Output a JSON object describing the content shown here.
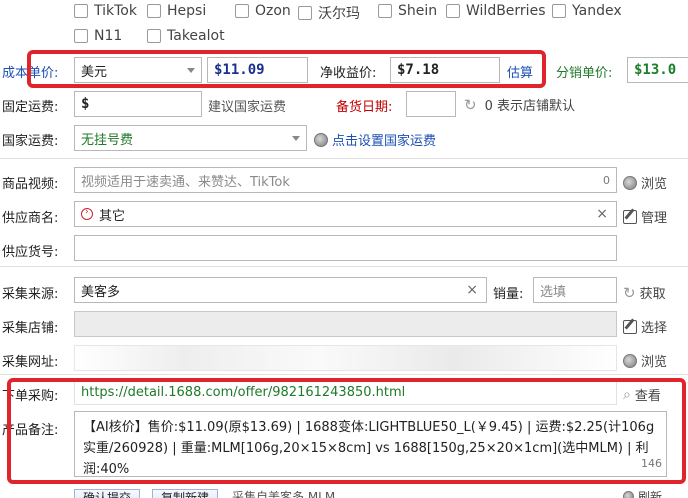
{
  "platforms": {
    "row1": [
      "TikTok",
      "Hepsi",
      "Ozon",
      "沃尔玛",
      "Shein",
      "WildBerries",
      "Yandex"
    ],
    "row2": [
      "N11",
      "Takealot"
    ]
  },
  "cost": {
    "label": "成本单价:",
    "currency": "美元",
    "value": "$11.09",
    "net_label": "净收益价:",
    "net_value": "$7.18",
    "estimate_link": "估算",
    "dist_label": "分销单价:",
    "dist_value": "$13.0"
  },
  "fixed_shipping": {
    "label": "固定运费:",
    "value": "$",
    "hint": "建议国家运费",
    "stock_label": "备货日期:",
    "stock_value": "",
    "stock_hint": "0 表示店铺默认"
  },
  "country_shipping": {
    "label": "国家运费:",
    "value": "无挂号费",
    "link": "点击设置国家运费"
  },
  "video": {
    "label": "商品视频:",
    "placeholder": "视频适用于速卖通、来赞达、TikTok",
    "count": "0",
    "browse": "浏览"
  },
  "supplier": {
    "label": "供应商名:",
    "value": "其它",
    "manage": "管理"
  },
  "supplier_sku": {
    "label": "供应货号:",
    "value": ""
  },
  "source": {
    "label": "采集来源:",
    "value": "美客多",
    "sales_label": "销量:",
    "sales_placeholder": "选填",
    "fetch": "获取"
  },
  "store": {
    "label": "采集店铺:",
    "value": "",
    "choose": "选择"
  },
  "url": {
    "label": "采集网址:",
    "value": "",
    "browse": "浏览"
  },
  "purchase": {
    "label": "下单采购:",
    "value": "https://detail.1688.com/offer/982161243850.html",
    "view": "查看"
  },
  "remark": {
    "label": "产品备注:",
    "text": "【AI核价】售价:$11.09(原$13.69) | 1688变体:LIGHTBLUE50_L(￥9.45) | 运费:$2.25(计106g实重/260928) | 重量:MLM[106g,20×15×8cm]  vs  1688[150g,25×20×1cm](选中MLM) | 利润:40%",
    "count": "146"
  },
  "footer": {
    "confirm": "确认提交",
    "copy_new": "复制新建",
    "collect_cloud": "采集自美客多 MLM",
    "refresh": "刷新"
  },
  "colors": {
    "highlight_red": "#e0242b",
    "money_blue": "#1c2f8f",
    "link_blue": "#1a4fb5",
    "green": "#1a7f2a"
  }
}
